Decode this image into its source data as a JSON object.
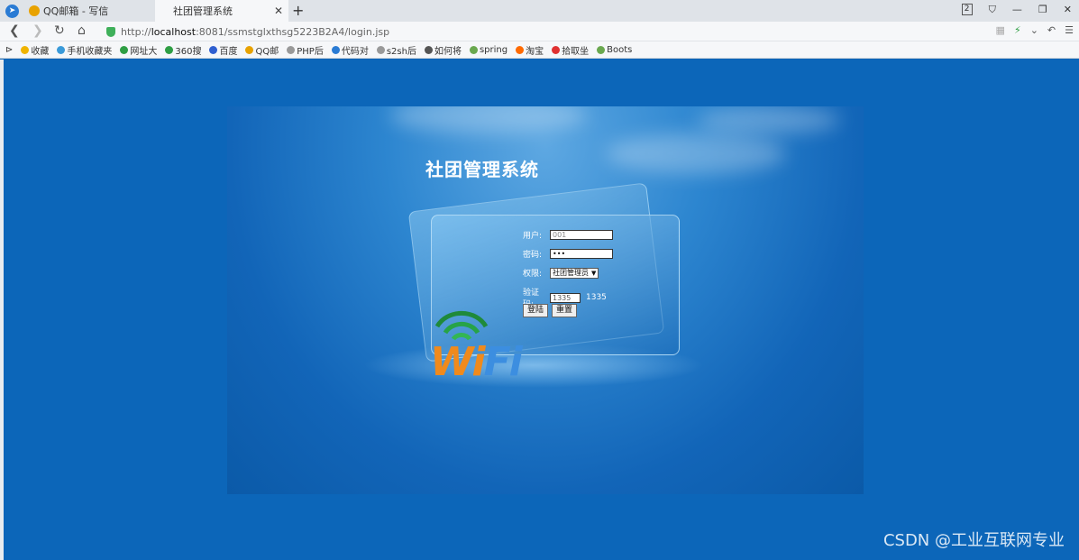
{
  "browser": {
    "tabs": [
      {
        "label": "QQ邮箱 - 写信",
        "active": false
      },
      {
        "label": "社团管理系统",
        "active": true
      }
    ],
    "window_badge": "2",
    "url_prefix": "http://",
    "url_host": "localhost",
    "url_rest": ":8081/ssmstglxthsg5223B2A4/login.jsp"
  },
  "bookmarks": [
    {
      "label": "收藏",
      "icon": "star-icon",
      "color": "#f0b400"
    },
    {
      "label": "手机收藏夹",
      "icon": "phone-icon",
      "color": "#3a9ad9"
    },
    {
      "label": "网址大",
      "icon": "globe-icon",
      "color": "#2f9e44"
    },
    {
      "label": "360搜",
      "icon": "search-icon",
      "color": "#2f9e44"
    },
    {
      "label": "百度",
      "icon": "paw-icon",
      "color": "#2f5fd0"
    },
    {
      "label": "QQ邮",
      "icon": "mail-icon",
      "color": "#e8a200"
    },
    {
      "label": "PHP后",
      "icon": "page-icon",
      "color": "#999999"
    },
    {
      "label": "代码对",
      "icon": "code-icon",
      "color": "#2a7bd4"
    },
    {
      "label": "s2sh后",
      "icon": "page-icon",
      "color": "#999999"
    },
    {
      "label": "如何将",
      "icon": "paw-icon",
      "color": "#555555"
    },
    {
      "label": "spring",
      "icon": "leaf-icon",
      "color": "#6aa84f"
    },
    {
      "label": "淘宝",
      "icon": "taobao-icon",
      "color": "#ff6a00"
    },
    {
      "label": "拾取坐",
      "icon": "pin-icon",
      "color": "#e03131"
    },
    {
      "label": "Boots",
      "icon": "bootstrap-icon",
      "color": "#6aa84f"
    }
  ],
  "login": {
    "title": "社团管理系统",
    "user_label": "用户:",
    "user_value": "001",
    "password_label": "密码:",
    "password_value": "•••",
    "role_label": "权限:",
    "role_selected": "社团管理员",
    "captcha_label": "验证码:",
    "captcha_input": "1335",
    "captcha_code": "1335",
    "login_button": "登陆",
    "reset_button": "重置"
  },
  "decor": {
    "wifi_text_w": "Wi",
    "wifi_text_f": "Fi",
    "wifi_color": "#1f8a3a"
  },
  "watermark": "CSDN @工业互联网专业"
}
